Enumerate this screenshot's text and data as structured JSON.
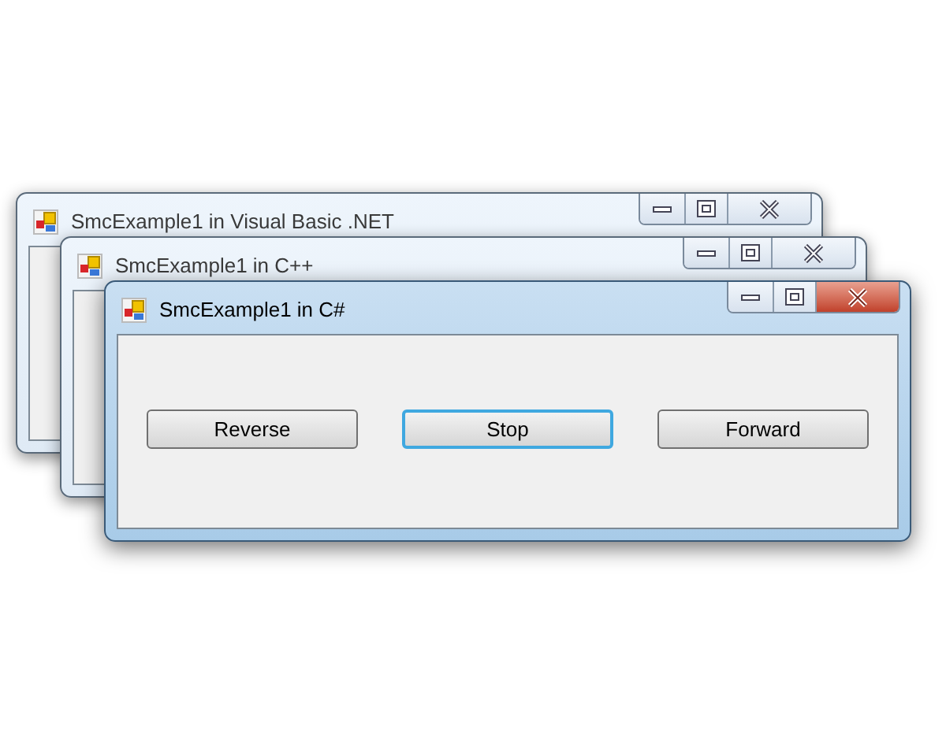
{
  "windows": [
    {
      "title": "SmcExample1 in Visual Basic .NET",
      "active": false
    },
    {
      "title": "SmcExample1 in C++",
      "active": false
    },
    {
      "title": "SmcExample1 in C#",
      "active": true,
      "buttons": [
        {
          "label": "Reverse",
          "focused": false
        },
        {
          "label": "Stop",
          "focused": true
        },
        {
          "label": "Forward",
          "focused": false
        }
      ]
    }
  ]
}
